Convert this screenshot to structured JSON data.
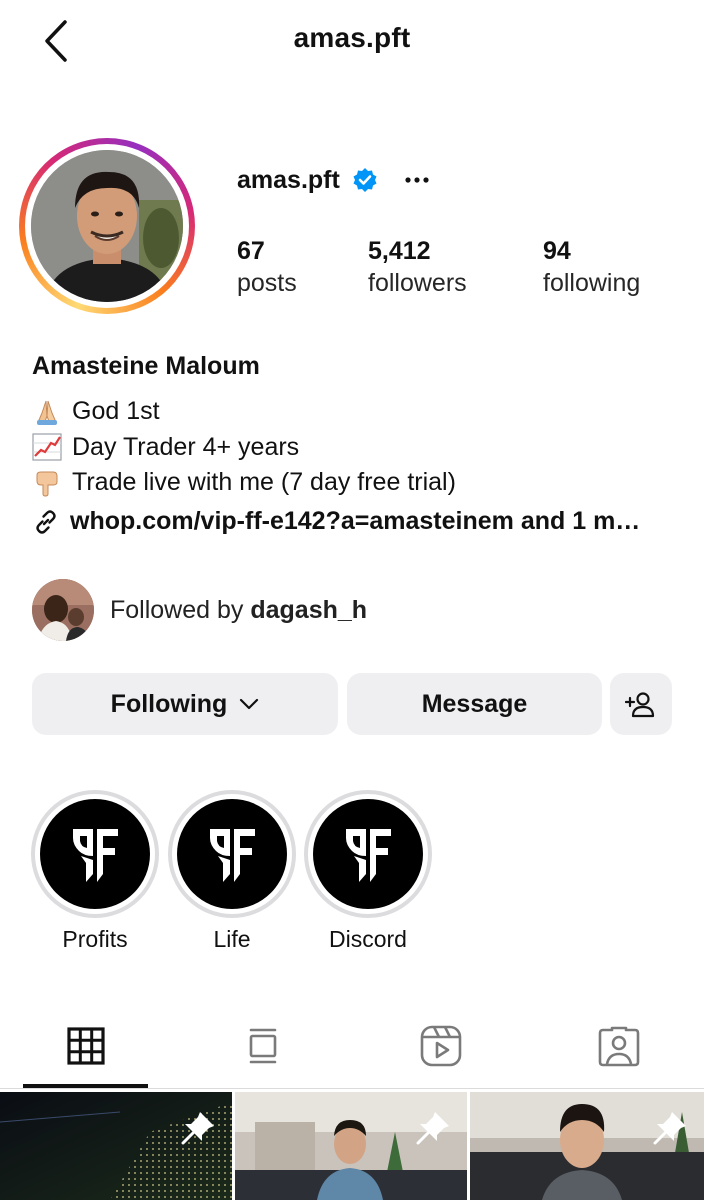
{
  "header": {
    "title": "amas.pft"
  },
  "profile": {
    "username": "amas.pft",
    "verified_icon": "verified-badge-icon",
    "accent_color": "#0095f6",
    "stats": [
      {
        "value": "67",
        "label": "posts"
      },
      {
        "value": "5,412",
        "label": "followers"
      },
      {
        "value": "94",
        "label": "following"
      }
    ],
    "full_name": "Amasteine Maloum",
    "bio_lines": [
      {
        "emoji": "folded-hands-icon",
        "text": "God 1st"
      },
      {
        "emoji": "chart-increasing-icon",
        "text": "Day Trader 4+ years"
      },
      {
        "emoji": "pointing-down-icon",
        "text": "Trade live with me (7 day free trial)"
      }
    ],
    "link": "whop.com/vip-ff-e142?a=amasteinem and 1 m…",
    "followed_by_prefix": "Followed by ",
    "followed_by_name": "dagash_h"
  },
  "actions": {
    "following_label": "Following",
    "message_label": "Message"
  },
  "highlights": [
    {
      "label": "Profits"
    },
    {
      "label": "Life"
    },
    {
      "label": "Discord"
    }
  ],
  "tabs": [
    "grid-icon",
    "feed-icon",
    "reels-icon",
    "tagged-icon"
  ]
}
